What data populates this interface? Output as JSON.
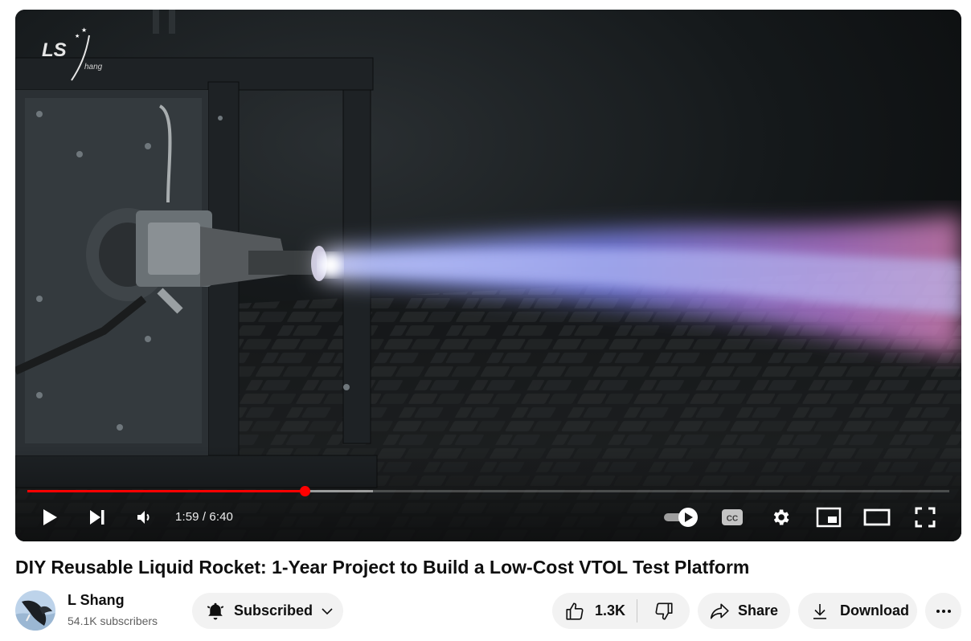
{
  "player": {
    "time_display": "1:59 / 6:40",
    "progress_fraction": 0.301,
    "buffered_fraction": 0.375,
    "watermark_text": "LS",
    "watermark_sub": "hang",
    "controls": {
      "play": "play-icon",
      "next": "next-icon",
      "volume": "volume-icon",
      "autoplay": "autoplay-toggle-icon",
      "captions": "captions-icon",
      "settings": "gear-icon",
      "miniplayer": "miniplayer-icon",
      "theater": "theater-mode-icon",
      "fullscreen": "fullscreen-icon"
    }
  },
  "video": {
    "title": "DIY Reusable Liquid Rocket: 1-Year Project to Build a Low-Cost VTOL Test Platform"
  },
  "channel": {
    "name": "L Shang",
    "subscribers": "54.1K subscribers"
  },
  "actions": {
    "subscribe_label": "Subscribed",
    "like_count": "1.3K",
    "share_label": "Share",
    "download_label": "Download"
  },
  "colors": {
    "progress_played": "#ff0000",
    "button_bg": "#f2f2f2",
    "text_primary": "#0f0f0f",
    "text_secondary": "#606060"
  }
}
